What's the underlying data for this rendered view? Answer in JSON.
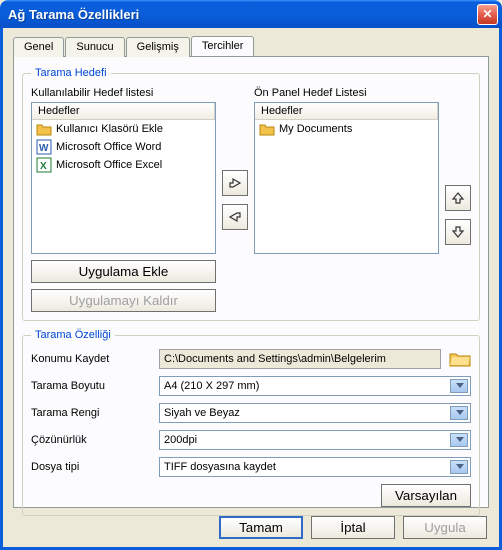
{
  "title": "Ağ Tarama Özellikleri",
  "tabs": [
    "Genel",
    "Sunucu",
    "Gelişmiş",
    "Tercihler"
  ],
  "active_tab": "Tercihler",
  "target_group": {
    "legend": "Tarama Hedefi",
    "available_label": "Kullanılabilir Hedef listesi",
    "available_header": "Hedefler",
    "available_items": [
      {
        "icon": "folder",
        "label": "Kullanıcı Klasörü Ekle"
      },
      {
        "icon": "word",
        "label": "Microsoft Office Word"
      },
      {
        "icon": "excel",
        "label": "Microsoft Office Excel"
      }
    ],
    "panel_label": "Ön Panel Hedef Listesi",
    "panel_header": "Hedefler",
    "panel_items": [
      {
        "icon": "folder",
        "label": "My Documents"
      }
    ],
    "add_app": "Uygulama Ekle",
    "remove_app": "Uygulamayı Kaldır"
  },
  "prop_group": {
    "legend": "Tarama Özelliği",
    "rows": {
      "save_loc_label": "Konumu Kaydet",
      "save_loc_value": "C:\\Documents and Settings\\admin\\Belgelerim",
      "size_label": "Tarama Boyutu",
      "size_value": "A4 (210 X 297 mm)",
      "color_label": "Tarama Rengi",
      "color_value": "Siyah ve Beyaz",
      "res_label": "Çözünürlük",
      "res_value": "200dpi",
      "ft_label": "Dosya tipi",
      "ft_value": "TIFF dosyasına kaydet"
    },
    "defaults": "Varsayılan"
  },
  "footer": {
    "ok": "Tamam",
    "cancel": "İptal",
    "apply": "Uygula"
  }
}
